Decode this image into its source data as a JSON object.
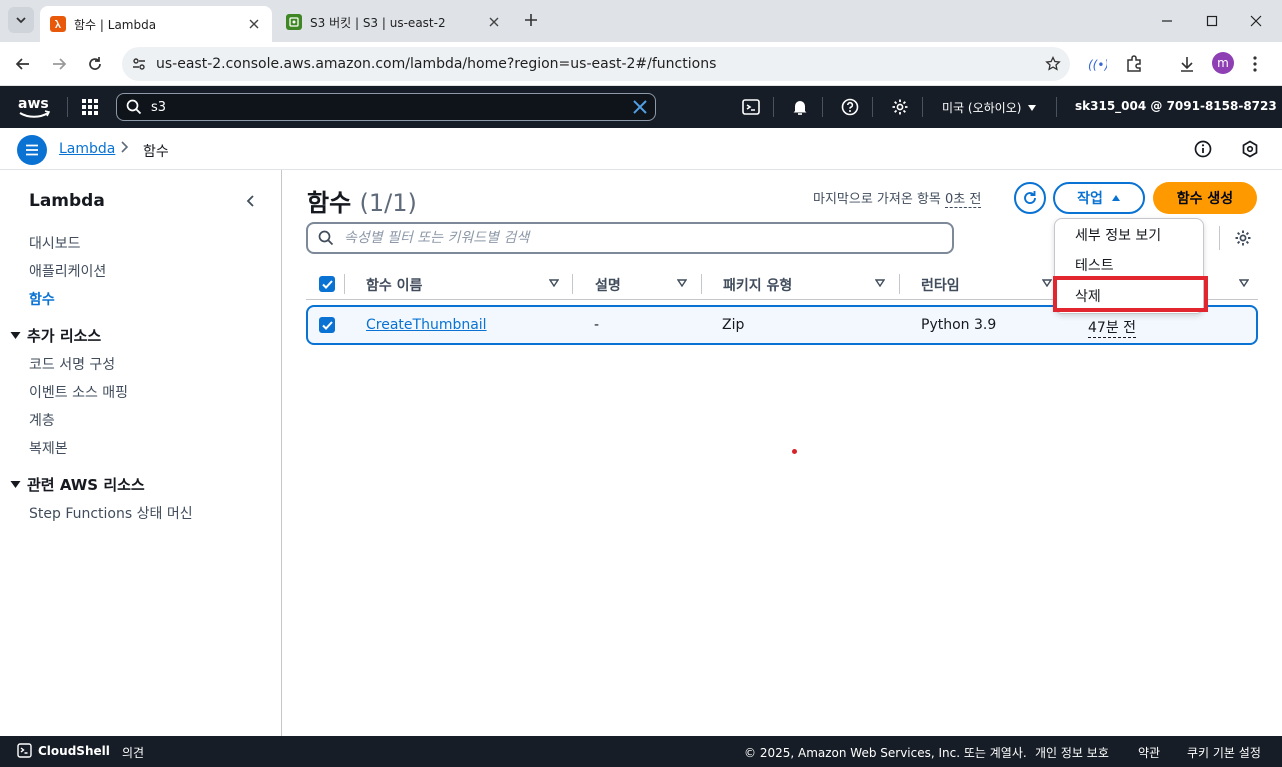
{
  "browser": {
    "tabs": [
      {
        "title": "함수 | Lambda",
        "active": true
      },
      {
        "title": "S3 버킷 | S3 | us-east-2",
        "active": false
      }
    ],
    "url": "us-east-2.console.aws.amazon.com/lambda/home?region=us-east-2#/functions",
    "profile_initial": "m"
  },
  "aws_header": {
    "search_value": "s3",
    "region": "미국 (오하이오)",
    "account": "sk315_004 @ 7091-8158-8723"
  },
  "breadcrumb": {
    "service": "Lambda",
    "current": "함수"
  },
  "sidebar": {
    "title": "Lambda",
    "items": [
      "대시보드",
      "애플리케이션",
      "함수"
    ],
    "section_additional": {
      "title": "추가 리소스",
      "items": [
        "코드 서명 구성",
        "이벤트 소스 매핑",
        "계층",
        "복제본"
      ]
    },
    "section_related": {
      "title": "관련 AWS 리소스",
      "items": [
        "Step Functions 상태 머신"
      ]
    }
  },
  "main": {
    "title": "함수",
    "count": "(1/1)",
    "last_fetched_prefix": "마지막으로 가져온 항목",
    "last_fetched_time": "0초 전",
    "actions_label": "작업",
    "create_label": "함수 생성",
    "filter_placeholder": "속성별 필터 또는 키워드별 검색",
    "columns": [
      "함수 이름",
      "설명",
      "패키지 유형",
      "런타임"
    ],
    "rows": [
      {
        "name": "CreateThumbnail",
        "description": "-",
        "package_type": "Zip",
        "runtime": "Python 3.9",
        "last_modified": "47분 전"
      }
    ],
    "actions_menu": [
      "세부 정보 보기",
      "테스트",
      "삭제"
    ]
  },
  "footer": {
    "cloudshell": "CloudShell",
    "feedback": "의견",
    "copyright": "© 2025, Amazon Web Services, Inc. 또는 계열사.",
    "privacy": "개인 정보 보호",
    "terms": "약관",
    "cookies": "쿠키 기본 설정"
  },
  "colors": {
    "aws_nav": "#161d26",
    "link": "#0972d3",
    "primary_button": "#ff9900",
    "highlight": "#e2262f"
  }
}
